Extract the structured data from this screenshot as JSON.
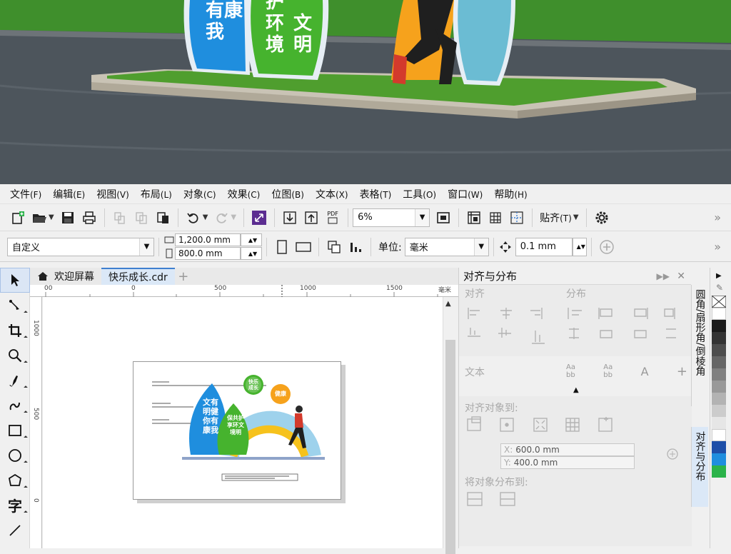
{
  "photo": {
    "sign_blue_text": [
      "有康",
      "我"
    ],
    "sign_green_text": [
      "护",
      "环 文",
      "境 明"
    ],
    "colors": {
      "road": "#4d555c",
      "grass": "#3b8a2a",
      "sign_blue": "#1f8ede",
      "sign_green": "#46b32e",
      "sign_orange": "#f6a21c",
      "sign_teal": "#6bbcd3"
    }
  },
  "menubar": {
    "items": [
      {
        "label": "文件",
        "acc": "(F)"
      },
      {
        "label": "编辑",
        "acc": "(E)"
      },
      {
        "label": "视图",
        "acc": "(V)"
      },
      {
        "label": "布局",
        "acc": "(L)"
      },
      {
        "label": "对象",
        "acc": "(C)"
      },
      {
        "label": "效果",
        "acc": "(C)"
      },
      {
        "label": "位图",
        "acc": "(B)"
      },
      {
        "label": "文本",
        "acc": "(X)"
      },
      {
        "label": "表格",
        "acc": "(T)"
      },
      {
        "label": "工具",
        "acc": "(O)"
      },
      {
        "label": "窗口",
        "acc": "(W)"
      },
      {
        "label": "帮助",
        "acc": "(H)"
      }
    ]
  },
  "toolbar1": {
    "zoom_value": "6%",
    "snap_label": "贴齐",
    "snap_acc": "(T)",
    "pdf_label": "PDF"
  },
  "toolbar2": {
    "page_preset": "自定义",
    "width": "1,200.0 mm",
    "height": "800.0 mm",
    "unit_label": "单位:",
    "unit_value": "毫米",
    "nudge": "0.1 mm"
  },
  "tabs": {
    "welcome": "欢迎屏幕",
    "document": "快乐成长.cdr",
    "plus": "+"
  },
  "ruler": {
    "top_labels": [
      "00",
      "0",
      "500",
      "1000",
      "1500",
      "毫米"
    ],
    "left_labels": [
      "1000",
      "500",
      "0"
    ]
  },
  "artwork": {
    "blue_text": "文有明健你有康我",
    "green_text": "保共护享环文境明",
    "bubble_green": "快乐成长",
    "bubble_orange": "健康"
  },
  "docker": {
    "title": "对齐与分布",
    "align_label": "对齐",
    "distribute_label": "分布",
    "text_label": "文本",
    "align_to_label": "对齐对象到:",
    "x_value": "600.0 mm",
    "y_value": "400.0 mm",
    "x_prefix": "X:",
    "y_prefix": "Y:",
    "distribute_to_label": "将对象分布到:"
  },
  "side_tabs": {
    "tab1": "圆角/扇形角/倒棱角",
    "tab2": "对齐与分布"
  },
  "palette": {
    "colors": [
      "#ffffff",
      "#1a1a1a",
      "#333333",
      "#4d4d4d",
      "#666666",
      "#808080",
      "#999999",
      "#b3b3b3",
      "#cccccc",
      "#e6e6e6",
      "#ffffff",
      "#1e4fa8",
      "#1f8ede",
      "#2bb34a"
    ]
  }
}
